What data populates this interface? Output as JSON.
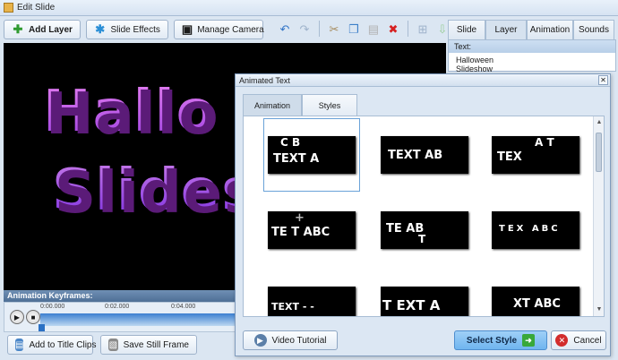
{
  "window": {
    "title": "Edit Slide"
  },
  "toolbar": {
    "add_layer": "Add Layer",
    "slide_effects": "Slide Effects",
    "manage_camera": "Manage Camera"
  },
  "preview": {
    "line1": "Hallo",
    "line2": "Slides"
  },
  "keyframes": {
    "header": "Animation Keyframes:",
    "ticks": [
      "0:00.000",
      "0:02.000",
      "0:04.000"
    ]
  },
  "bottom": {
    "add_title_clips": "Add to Title Clips",
    "save_still": "Save Still Frame"
  },
  "right_tabs": [
    "Slide",
    "Layer",
    "Animation",
    "Sounds"
  ],
  "right_panel": {
    "header": "Text:",
    "value_line1": "Halloween",
    "value_line2": "Slideshow"
  },
  "dialog": {
    "title": "Animated Text",
    "tabs": [
      "Animation",
      "Styles"
    ],
    "thumbs": [
      {
        "text": "TEXT A",
        "extra": "C B"
      },
      {
        "text": "TEXT AB",
        "extra": ""
      },
      {
        "text": "TEX",
        "extra": "A T"
      },
      {
        "text": "TE  T ABC",
        "extra": "+"
      },
      {
        "text": "TE   AB",
        "extra": "T"
      },
      {
        "text": "TEX  ABC",
        "extra": ""
      },
      {
        "text": "TEXT - -",
        "extra": ""
      },
      {
        "text": "T EXT A",
        "extra": ""
      },
      {
        "text": "XT ABC",
        "extra": ""
      }
    ],
    "video_tutorial": "Video Tutorial",
    "select_style": "Select Style",
    "cancel": "Cancel"
  },
  "colors": {
    "accent": "#6fb5ef",
    "title_purple": "#c85ee8"
  }
}
